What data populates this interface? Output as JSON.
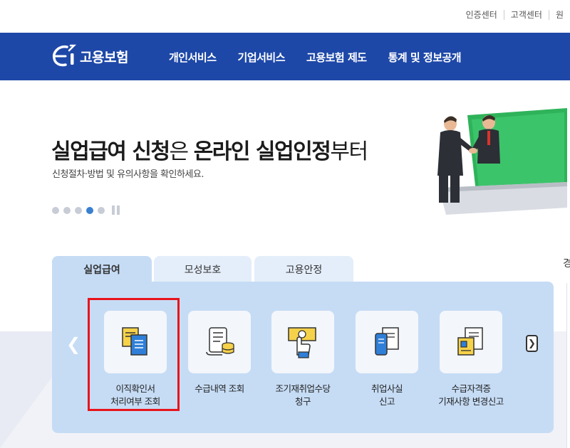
{
  "utility": {
    "links": [
      "인증센터",
      "고객센터",
      "원"
    ]
  },
  "nav": {
    "logo": "고용보험",
    "menu": [
      "개인서비스",
      "기업서비스",
      "고용보험 제도",
      "통계 및 정보공개"
    ]
  },
  "hero": {
    "title_part1": "실업급여 신청",
    "title_part2": "은 ",
    "title_part3": "온라인 실업인정",
    "title_part4": "부터",
    "subtitle": "신청절차·방법 및 유의사항을 확인하세요.",
    "slide_count": 5,
    "active_slide": 4
  },
  "side": {
    "edge_text": "경"
  },
  "tabs": [
    {
      "label": "실업급여",
      "active": true
    },
    {
      "label": "모성보호",
      "active": false
    },
    {
      "label": "고용안정",
      "active": false
    }
  ],
  "services": [
    {
      "label": "이직확인서\n처리여부 조회",
      "icon": "document-copy-icon"
    },
    {
      "label": "수급내역 조회",
      "icon": "receipt-coins-icon"
    },
    {
      "label": "조기재취업수당\n청구",
      "icon": "money-hand-icon"
    },
    {
      "label": "취업사실\n신고",
      "icon": "phone-document-icon"
    },
    {
      "label": "수급자격증\n기재사항 변경신고",
      "icon": "certificate-edit-icon"
    }
  ],
  "colors": {
    "nav": "#1e48a8",
    "panel": "#c6dcf5",
    "highlight": "#e8141a",
    "accent": "#3a7fd0"
  }
}
